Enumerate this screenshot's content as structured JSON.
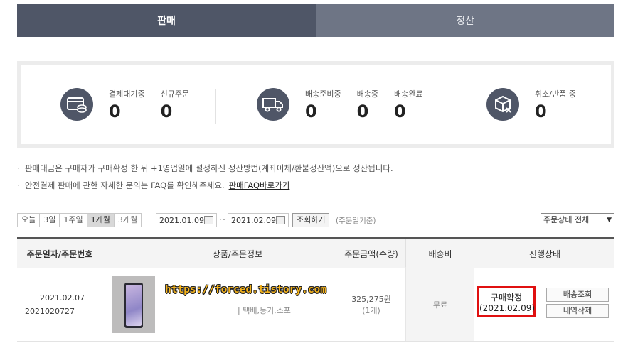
{
  "tabs": {
    "sales": "판매",
    "settlement": "정산"
  },
  "summary": {
    "group1": [
      {
        "label": "결제대기중",
        "count": "0"
      },
      {
        "label": "신규주문",
        "count": "0"
      }
    ],
    "group2": [
      {
        "label": "배송준비중",
        "count": "0"
      },
      {
        "label": "배송중",
        "count": "0"
      },
      {
        "label": "배송완료",
        "count": "0"
      }
    ],
    "group3": [
      {
        "label": "취소/반품 중",
        "count": "0"
      }
    ]
  },
  "notes": {
    "line1": "판매대금은 구매자가 구매확정 한 뒤 +1영업일에 설정하신 정산방법(계좌이체/환불정산액)으로 정산됩니다.",
    "line2": "안전결제 판매에 관한 자세한 문의는 FAQ를 확인해주세요.",
    "faq_link": "판매FAQ바로가기"
  },
  "filter": {
    "periods": [
      "오늘",
      "3일",
      "1주일",
      "1개월",
      "3개월"
    ],
    "selected_period": "1개월",
    "date_from": "2021.01.09",
    "date_to": "2021.02.09",
    "search_label": "조회하기",
    "basis": "(주문일기준)",
    "status_select": "주문상태 전체"
  },
  "table": {
    "headers": {
      "date": "주문일자/주문번호",
      "product": "상품/주문정보",
      "amount": "주문금액(수량)",
      "shipping": "배송비",
      "status": "진행상태"
    },
    "order": {
      "date": "2021.02.07",
      "number": "2021020727",
      "watermark": "https://forced.tistory.com",
      "delivery_info": "택배,등기,소포",
      "price": "325,275원",
      "qty": "(1개)",
      "shipping": "무료",
      "status": "구매확정",
      "status_date": "(2021.02.09)",
      "track_button": "배송조회",
      "delete_button": "내역삭제"
    }
  },
  "colors": {
    "tab_active": "#4f5667",
    "tab_inactive": "#6e7585",
    "highlight_box": "#e01010",
    "watermark_fill": "#f4b21b"
  }
}
